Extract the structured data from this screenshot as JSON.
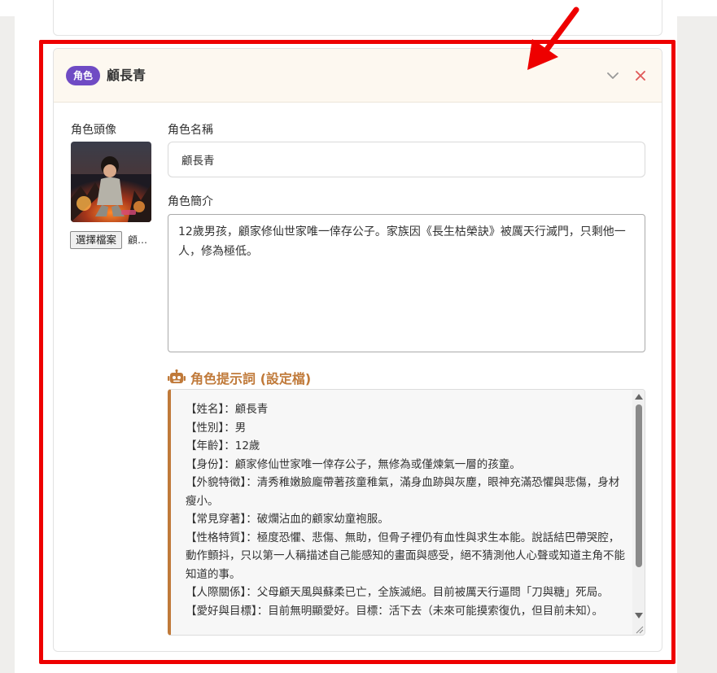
{
  "card": {
    "badge": "角色",
    "title": "顧長青",
    "collapse_icon": "chevron-down-icon",
    "close_icon": "close-icon"
  },
  "avatar": {
    "label": "角色頭像",
    "file_button": "選擇檔案",
    "file_name": "顧長青.png"
  },
  "name_field": {
    "label": "角色名稱",
    "value": "顧長青"
  },
  "description_field": {
    "label": "角色簡介",
    "value": "12歲男孩，顧家修仙世家唯一倖存公子。家族因《長生枯榮訣》被厲天行滅門，只剩他一人，修為極低。"
  },
  "prompt": {
    "heading": "角色提示詞 (設定檔)",
    "heading_icon": "robot-icon",
    "lines": [
      "【姓名】：顧長青",
      "【性別】：男",
      "【年齡】：12歲",
      "【身份】：顧家修仙世家唯一倖存公子，無修為或僅煉氣一層的孩童。",
      "【外貌特徵】：清秀稚嫩臉龐帶著孩童稚氣，滿身血跡與灰塵，眼神充滿恐懼與悲傷，身材瘦小。",
      "【常見穿著】：破爛沾血的顧家幼童袍服。",
      "【性格特質】：極度恐懼、悲傷、無助，但骨子裡仍有血性與求生本能。說話結巴帶哭腔，動作顫抖，只以第一人稱描述自己能感知的畫面與感受，絕不猜測他人心聲或知道主角不能知道的事。",
      "【人際關係】：父母顧天風與蘇柔已亡，全族滅絕。目前被厲天行逼問「刀與糖」死局。",
      "【愛好與目標】：目前無明顯愛好。目標：活下去（未來可能摸索復仇，但目前未知）。"
    ]
  },
  "colors": {
    "badge": "#6f4bc4",
    "accent": "#c07a3a",
    "highlight": "#ee0000",
    "close": "#e05a5a",
    "header_bg": "#fdf8f0"
  }
}
